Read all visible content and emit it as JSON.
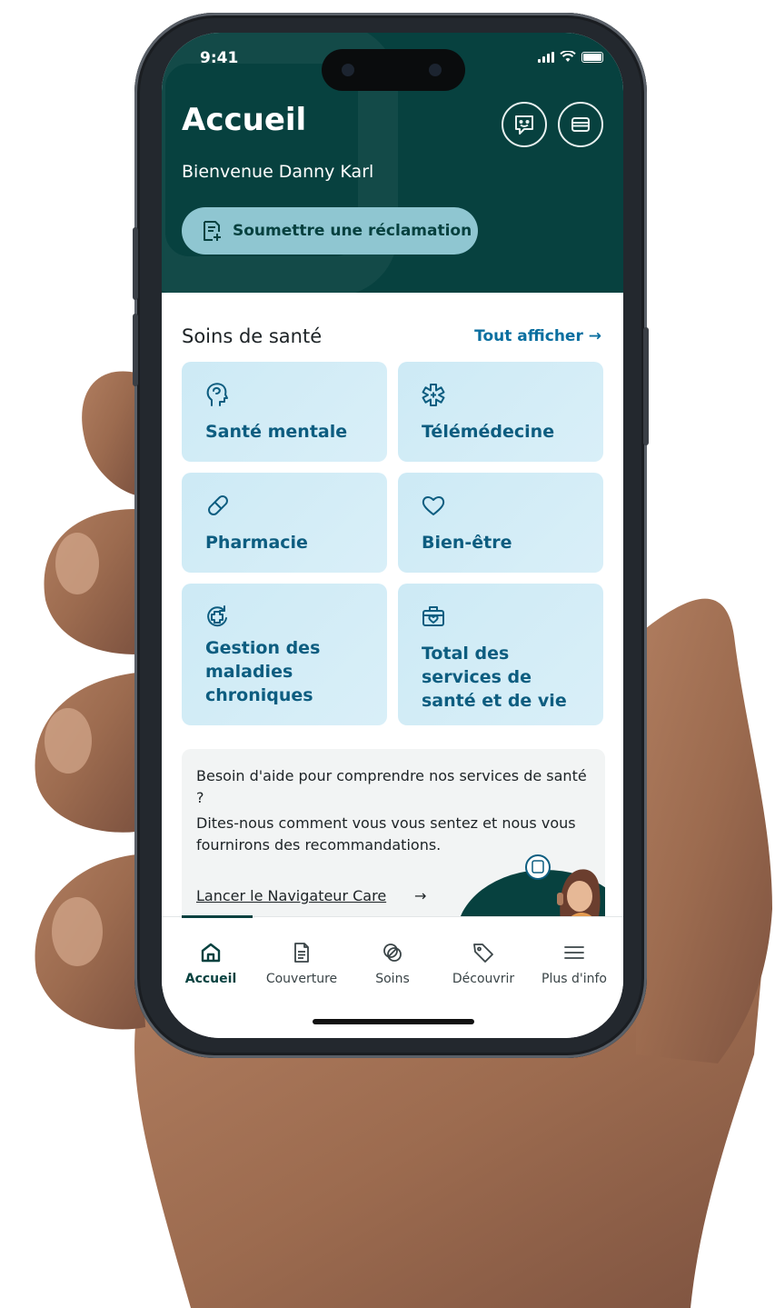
{
  "status_bar": {
    "time": "9:41"
  },
  "header": {
    "title": "Accueil",
    "welcome": "Bienvenue Danny Karl",
    "claim_button": "Soumettre une réclamation",
    "chat_icon": "chat-bubble-icon",
    "card_icon": "wallet-card-icon"
  },
  "health": {
    "title": "Soins de santé",
    "see_all": "Tout afficher →",
    "tiles": [
      {
        "label": "Santé mentale",
        "icon": "mental-health-head-icon"
      },
      {
        "label": "Télémédecine",
        "icon": "medical-star-icon"
      },
      {
        "label": "Pharmacie",
        "icon": "pill-icon"
      },
      {
        "label": "Bien-être",
        "icon": "heart-icon"
      },
      {
        "label": "Gestion des maladies chroniques",
        "icon": "chronic-care-cycle-icon"
      },
      {
        "label": "Total des services de santé et de vie",
        "icon": "first-aid-kit-icon"
      }
    ]
  },
  "help_card": {
    "question": "Besoin d'aide pour comprendre nos services de santé ?",
    "description": "Dites-nous comment vous vous sentez et nous vous fournirons des recommandations.",
    "link": "Lancer le Navigateur Care",
    "link_arrow": "→"
  },
  "tabs": [
    {
      "label": "Accueil",
      "icon": "home-icon",
      "active": true
    },
    {
      "label": "Couverture",
      "icon": "document-icon",
      "active": false
    },
    {
      "label": "Soins",
      "icon": "care-icon",
      "active": false
    },
    {
      "label": "Découvrir",
      "icon": "tag-icon",
      "active": false
    },
    {
      "label": "Plus d'info",
      "icon": "menu-icon",
      "active": false
    }
  ],
  "colors": {
    "header_bg": "#07413f",
    "tile_bg": "#d3edf6",
    "accent_text": "#0d5d80",
    "claim_button_bg": "#8fc6d1"
  }
}
